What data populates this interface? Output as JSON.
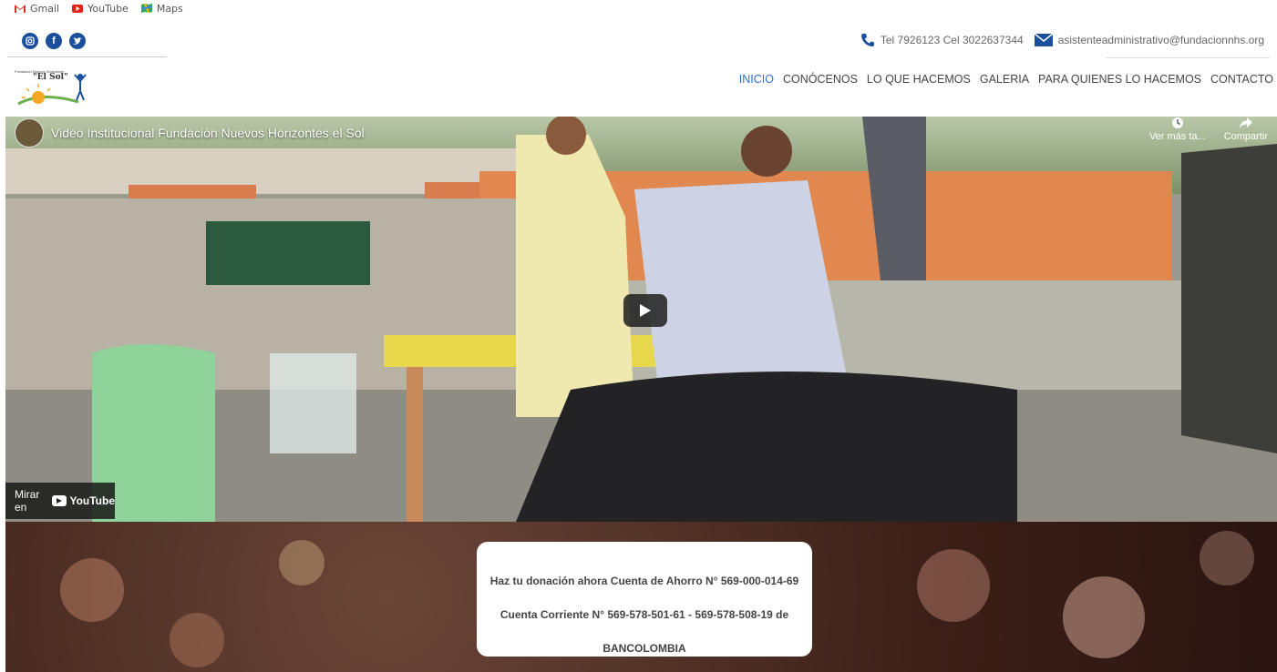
{
  "bookmarks": [
    {
      "label": "Gmail",
      "icon": "gmail-icon"
    },
    {
      "label": "YouTube",
      "icon": "youtube-icon"
    },
    {
      "label": "Maps",
      "icon": "maps-icon"
    }
  ],
  "social": [
    {
      "name": "instagram-icon"
    },
    {
      "name": "facebook-icon"
    },
    {
      "name": "twitter-icon"
    }
  ],
  "contact": {
    "phone": "Tel 7926123 Cel 3022637344",
    "email": "asistenteadministrativo@fundacionnhs.org"
  },
  "logo": {
    "text": "\"El Sol\"",
    "small": "Fundación Nuevos Horizontes"
  },
  "nav": {
    "items": [
      "INICIO",
      "CONÓCENOS",
      "LO QUE HACEMOS",
      "GALERIA",
      "PARA QUIENES LO HACEMOS",
      "CONTACTO"
    ],
    "active_index": 0
  },
  "video": {
    "title": "Video Institucional Fundación Nuevos Horizontes el Sol",
    "watch_later": "Ver más ta...",
    "share": "Compartir",
    "watch_on": "Mirar en",
    "youtube": "YouTube"
  },
  "donation": {
    "line1": "Haz tu donación ahora Cuenta de Ahorro N° 569-000-014-69",
    "line2": "Cuenta Corriente N° 569-578-501-61 - 569-578-508-19 de",
    "line3": "BANCOLOMBIA"
  },
  "colors": {
    "brand_blue": "#1a4f9c",
    "nav_active": "#2f6fd0"
  }
}
